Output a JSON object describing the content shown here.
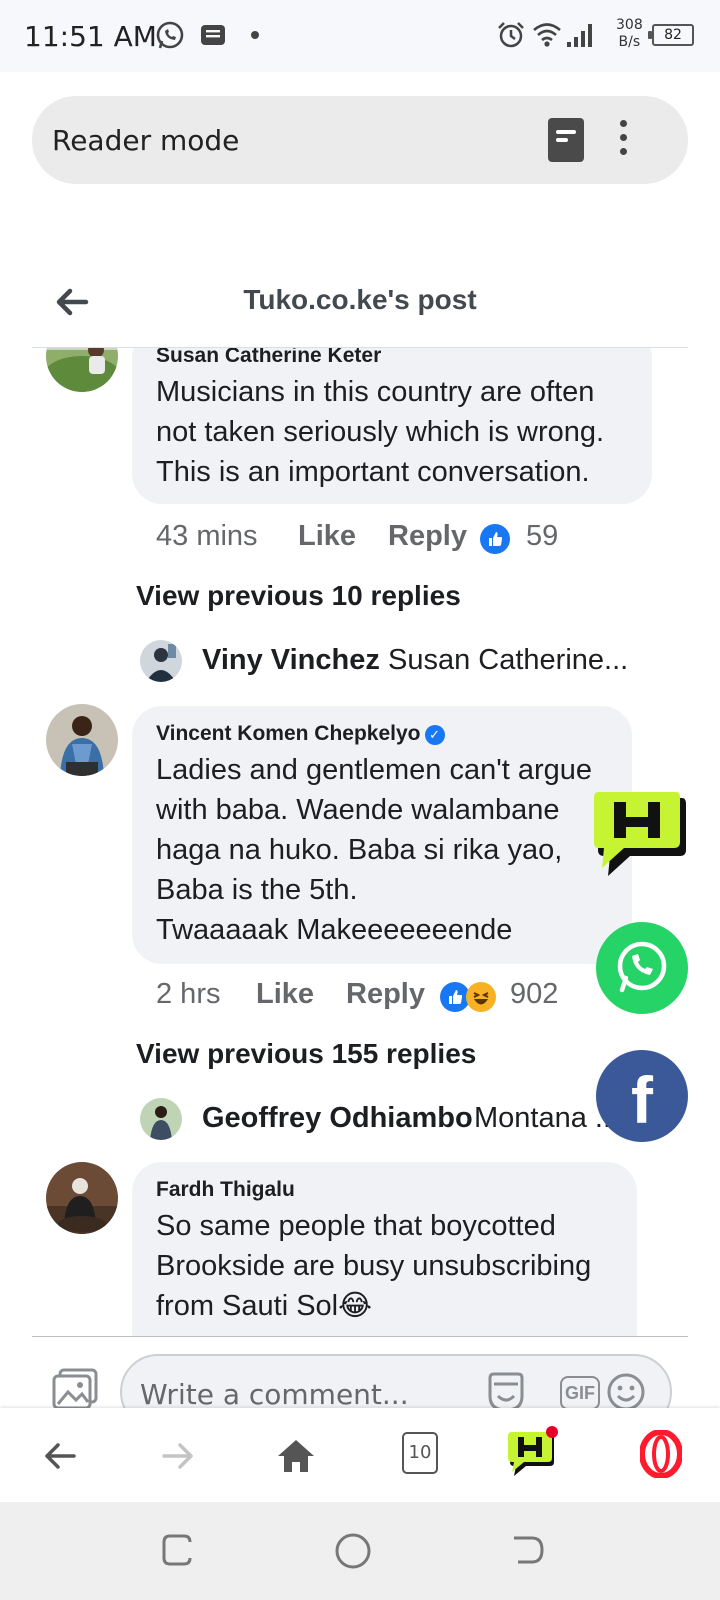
{
  "status_bar": {
    "time": "11:51 AM",
    "net_speed_value": "308",
    "net_speed_unit": "B/s",
    "battery": "82"
  },
  "reader_bar": {
    "label": "Reader mode"
  },
  "post_header": {
    "title": "Tuko.co.ke's post"
  },
  "comments": [
    {
      "author": "Susan Catherine Keter",
      "lines": [
        "Musicians in this country are often",
        "not taken seriously which is wrong.",
        "This is an important conversation."
      ],
      "time": "43 mins",
      "like_label": "Like",
      "reply_label": "Reply",
      "reaction_count": "59",
      "view_previous": "View previous 10 replies",
      "reply_preview": {
        "name": "Viny Vinchez",
        "text": "Susan Catherine..."
      }
    },
    {
      "author": "Vincent Komen Chepkelyo",
      "lines": [
        "Ladies and gentlemen can't argue",
        "with baba. Waende walambane",
        "haga na huko. Baba si rika yao,",
        "Baba is the 5th.",
        "Twaaaaak Makeeeeeeende"
      ],
      "time": "2 hrs",
      "like_label": "Like",
      "reply_label": "Reply",
      "reaction_count": "902",
      "view_previous": "View previous 155 replies",
      "reply_preview": {
        "name": "Geoffrey Odhiambo",
        "text": "Montana ..."
      }
    },
    {
      "author": "Fardh Thigalu",
      "lines": [
        "So same people that boycotted",
        "Brookside are busy unsubscribing",
        "from Sauti Sol😂"
      ]
    }
  ],
  "composer": {
    "placeholder": "Write a comment...",
    "gif_label": "GIF"
  },
  "browser_bar": {
    "tabs_count": "10"
  },
  "floating": {
    "facebook_glyph": "f"
  },
  "colors": {
    "facebook_blue": "#1877f2",
    "whatsapp_green": "#25d366",
    "facebook_share": "#3b5998",
    "hype_yellow": "#c6f432",
    "opera_red": "#ff1b2d"
  }
}
